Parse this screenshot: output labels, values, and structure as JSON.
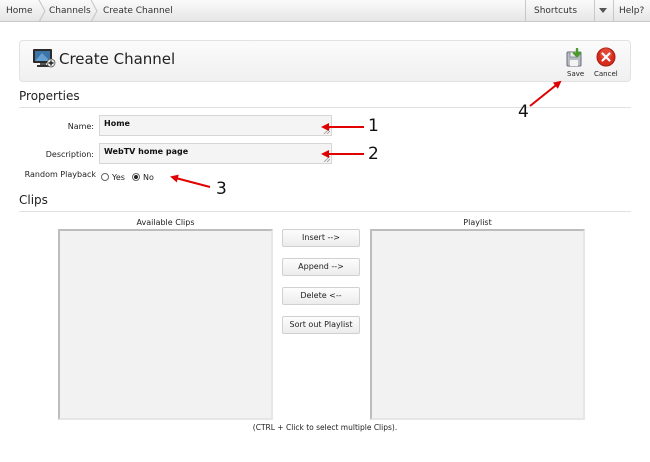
{
  "breadcrumb": [
    "Home",
    "Channels",
    "Create Channel"
  ],
  "topbar": {
    "shortcuts": "Shortcuts",
    "help": "Help?"
  },
  "header": {
    "title": "Create Channel",
    "save": "Save",
    "cancel": "Cancel"
  },
  "properties": {
    "title": "Properties",
    "name_label": "Name:",
    "name_value": "Home",
    "description_label": "Description:",
    "description_value": "WebTV home page",
    "random_label": "Random Playback",
    "option_yes": "Yes",
    "option_no": "No",
    "selected": "No"
  },
  "clips": {
    "title": "Clips",
    "available_caption": "Available Clips",
    "playlist_caption": "Playlist",
    "buttons": [
      "Insert -->",
      "Append -->",
      "Delete <--",
      "Sort out Playlist"
    ],
    "hint": "(CTRL + Click to select multiple Clips)."
  },
  "annotations": [
    "1",
    "2",
    "3",
    "4"
  ],
  "colors": {
    "annotation_arrow": "#e00000",
    "cancel_red": "#d92b1c",
    "save_green": "#4a9c2a"
  },
  "icons": [
    "channel-icon",
    "save-icon",
    "cancel-icon",
    "chevron-down-icon"
  ]
}
